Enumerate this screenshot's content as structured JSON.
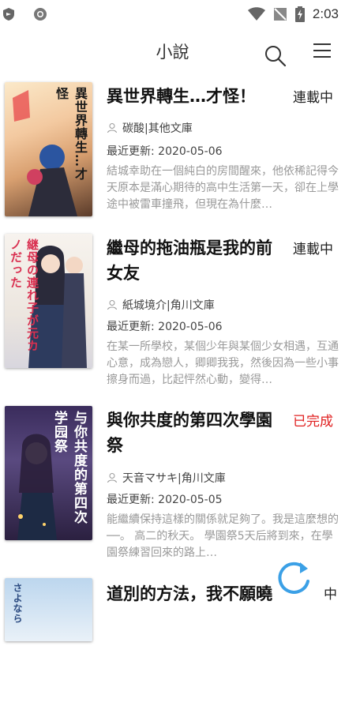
{
  "status_bar": {
    "time": "2:03"
  },
  "toolbar": {
    "title": "小說"
  },
  "books": [
    {
      "title": "異世界轉生…才怪！",
      "status": "連載中",
      "author": "碳酸|其他文庫",
      "updated": "最近更新: 2020-05-06",
      "summary": "結城幸助在一個純白的房間醒來，他依稀記得今天原本是滿心期待的高中生活第一天，卻在上學途中被雷車撞飛，但現在為什麼…",
      "cover_text": "異世界轉生…才怪"
    },
    {
      "title": "繼母的拖油瓶是我的前女友",
      "status": "連載中",
      "author": "紙城境介|角川文庫",
      "updated": "最近更新: 2020-05-06",
      "summary": "在某一所學校，某個少年與某個少女相遇，互通心意，成為戀人，卿卿我我，然後因為一些小事擦身而過，比起怦然心動，變得…",
      "cover_text": "継母の連れ子が元カノだった"
    },
    {
      "title": "與你共度的第四次學園祭",
      "status": "已完成",
      "author": "天音マサキ|角川文庫",
      "updated": "最近更新: 2020-05-05",
      "summary": "能繼續保持這樣的關係就足夠了。我是這麼想的──。 高二的秋天。 學園祭5天后將到來，在學園祭練習回來的路上…",
      "cover_text": "与你共度的第四次学园祭"
    },
    {
      "title": "道別的方法，我不願曉",
      "status": "中",
      "cover_text": "さよなら"
    }
  ],
  "colors": {
    "accent": "#3ba0e6",
    "done": "#e02020"
  }
}
